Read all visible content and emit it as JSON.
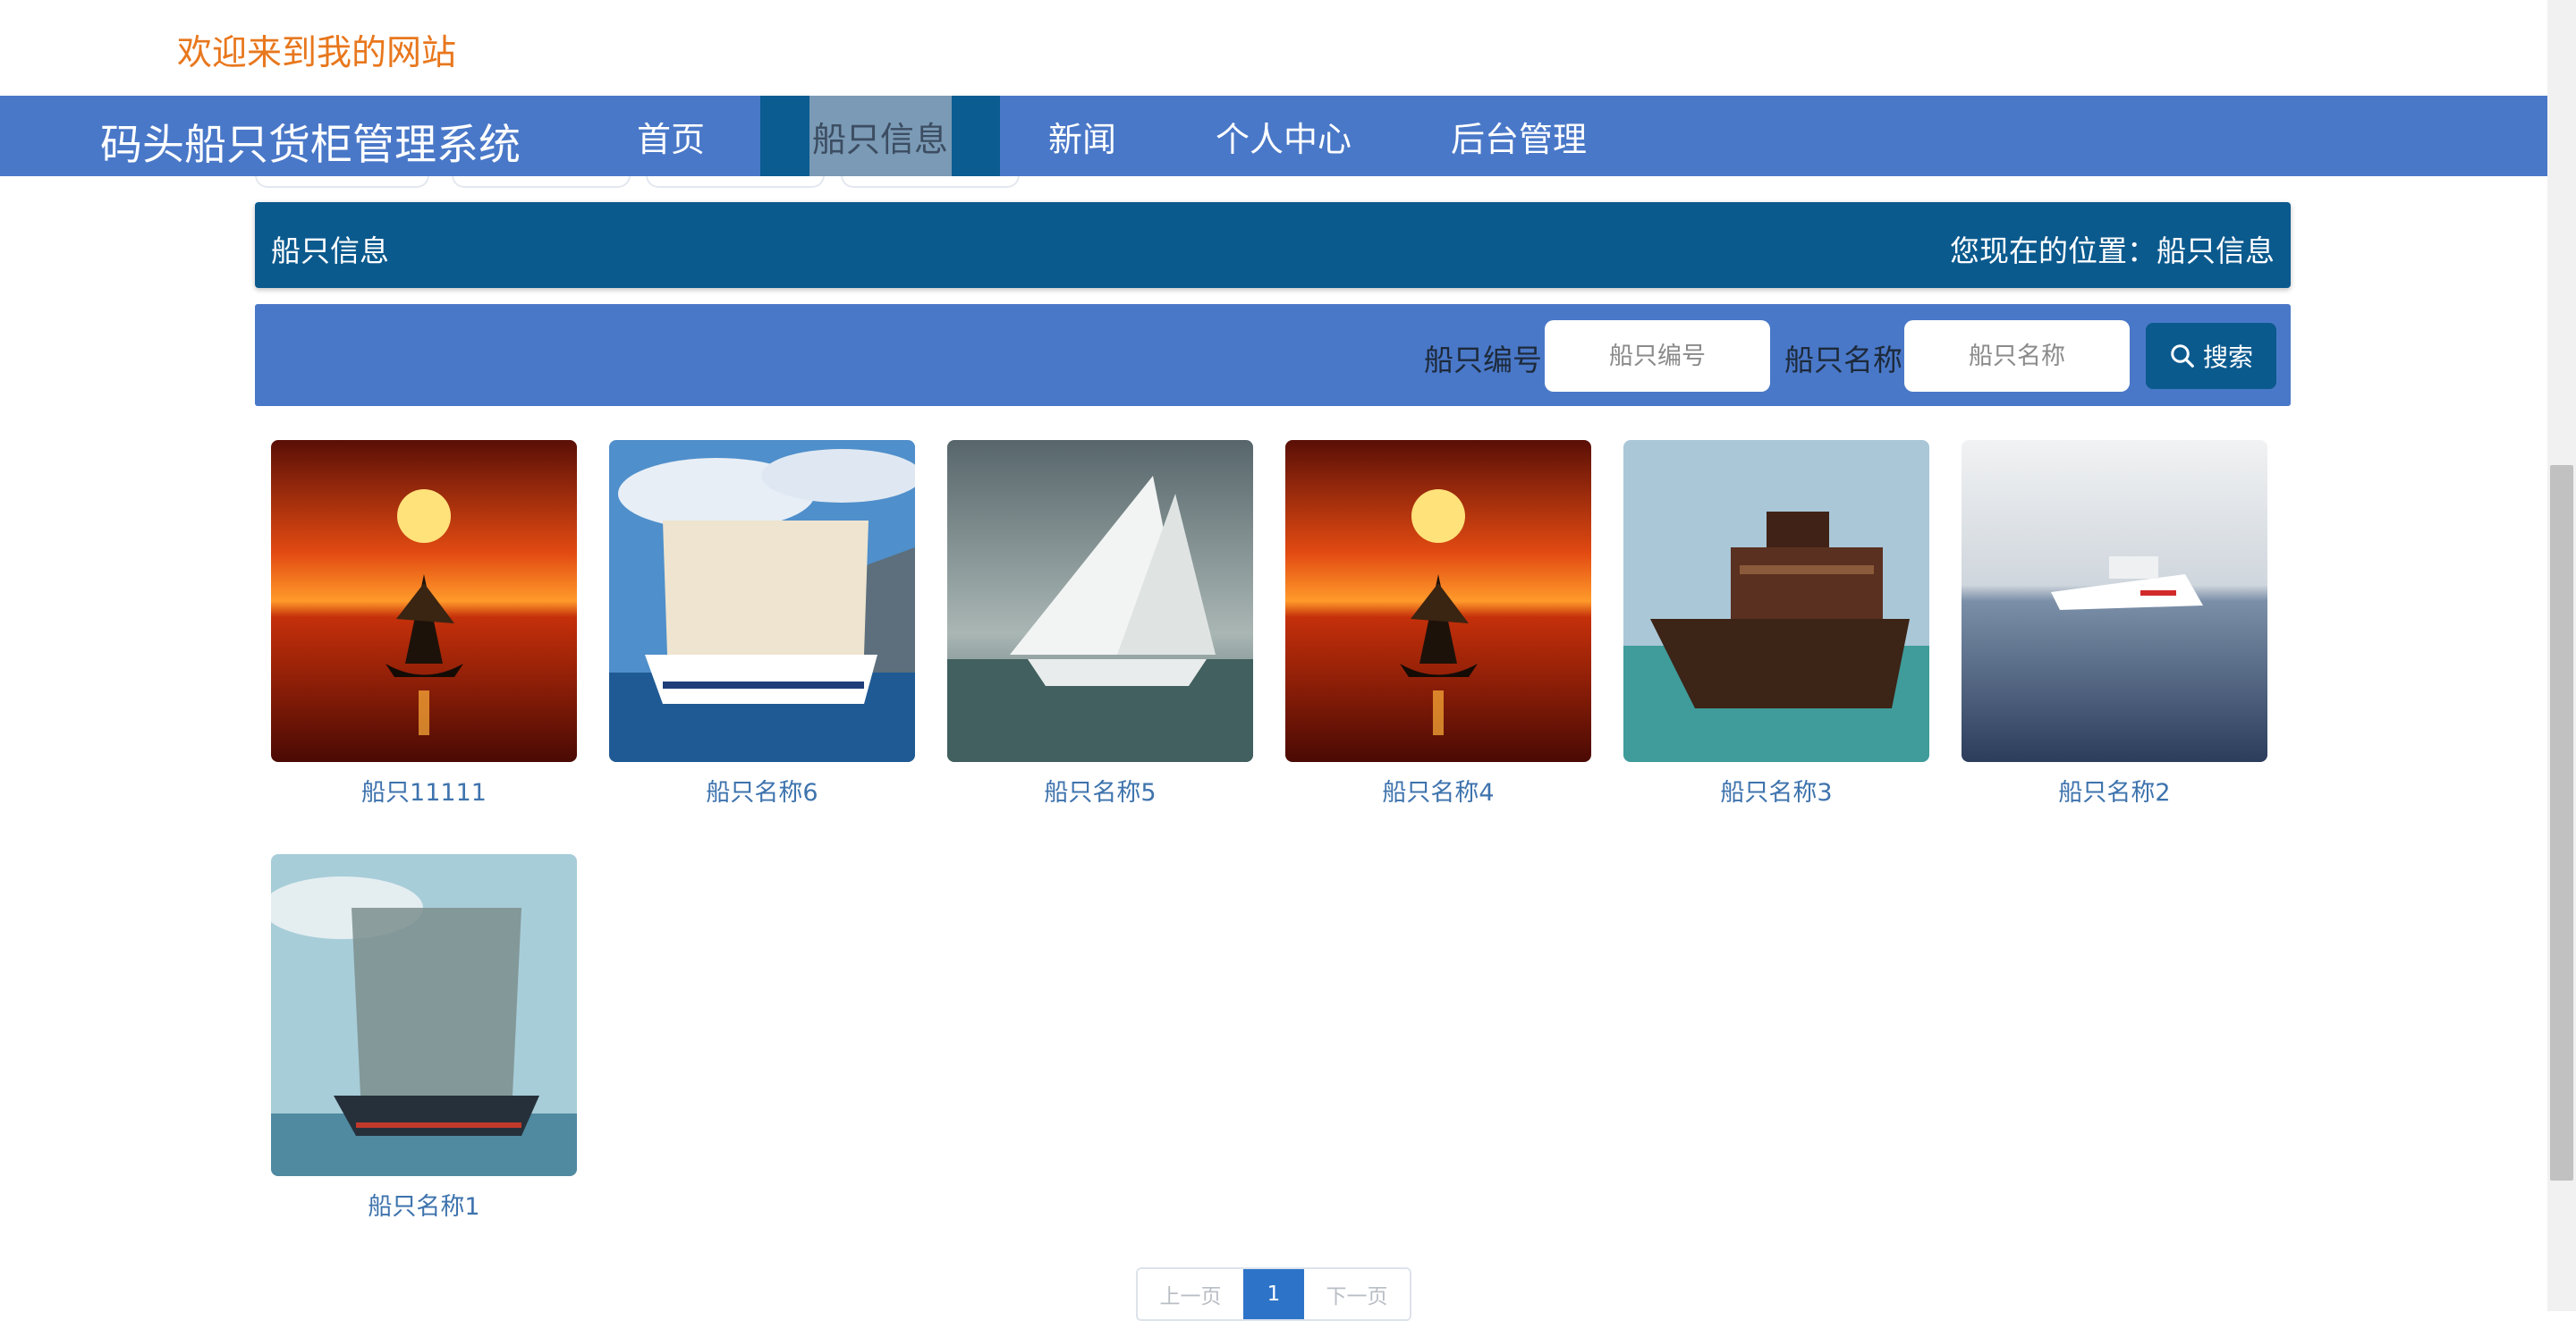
{
  "welcome": {
    "text": "欢迎来到我的网站"
  },
  "header": {
    "site_title": "码头船只货柜管理系统",
    "nav": [
      {
        "label": "首页"
      },
      {
        "label": "船只信息"
      },
      {
        "label": "新闻"
      },
      {
        "label": "个人中心"
      },
      {
        "label": "后台管理"
      }
    ]
  },
  "breadcrumb": {
    "title": "船只信息",
    "location": "您现在的位置：船只信息"
  },
  "search": {
    "field1_label": "船只编号",
    "field1_placeholder": "船只编号",
    "field2_label": "船只名称",
    "field2_placeholder": "船只名称",
    "button_label": "搜索"
  },
  "ships": [
    {
      "name": "船只11111",
      "image_icon": "sunset-sailing-ship-image"
    },
    {
      "name": "船只名称6",
      "image_icon": "tall-ship-blue-sky-image"
    },
    {
      "name": "船只名称5",
      "image_icon": "white-sail-ship-image"
    },
    {
      "name": "船只名称4",
      "image_icon": "sunset-sailing-ship-image"
    },
    {
      "name": "船只名称3",
      "image_icon": "wooden-boat-image"
    },
    {
      "name": "船只名称2",
      "image_icon": "coast-guard-boat-image"
    },
    {
      "name": "船只名称1",
      "image_icon": "old-tall-ship-image"
    }
  ],
  "pagination": {
    "prev": "上一页",
    "current": "1",
    "next": "下一页"
  },
  "colors": {
    "nav_bg": "#4a78c8",
    "accent_dark": "#0b5a8e",
    "welcome_orange": "#e8771d",
    "ship_name": "#3e73ad"
  }
}
